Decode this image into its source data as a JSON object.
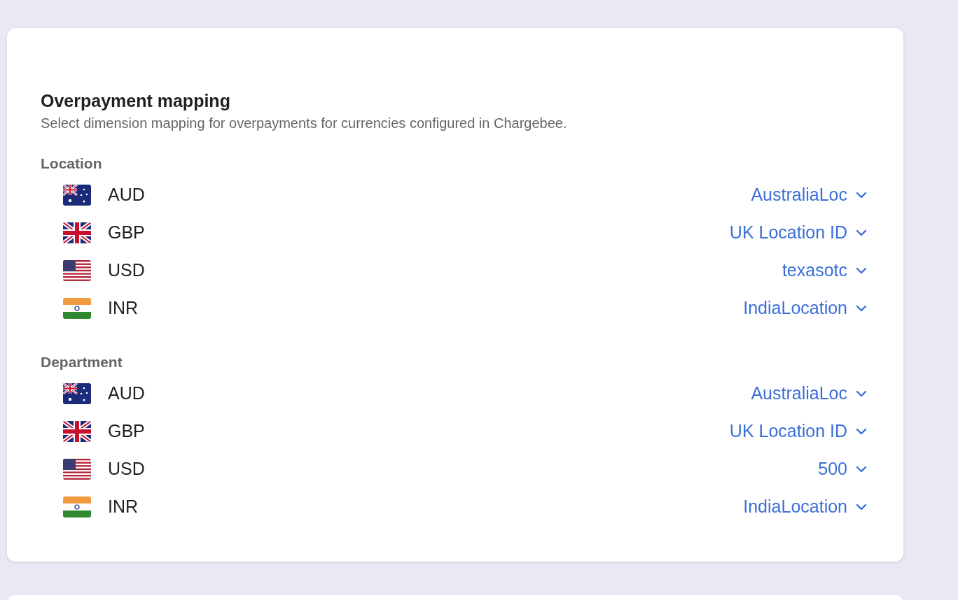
{
  "card": {
    "title": "Overpayment mapping",
    "description": "Select dimension mapping for overpayments for currencies configured in Chargebee.",
    "sections": [
      {
        "label": "Location",
        "rows": [
          {
            "currency": "AUD",
            "value": "AustraliaLoc"
          },
          {
            "currency": "GBP",
            "value": "UK Location ID"
          },
          {
            "currency": "USD",
            "value": "texasotc"
          },
          {
            "currency": "INR",
            "value": "IndiaLocation"
          }
        ]
      },
      {
        "label": "Department",
        "rows": [
          {
            "currency": "AUD",
            "value": "AustraliaLoc"
          },
          {
            "currency": "GBP",
            "value": "UK Location ID"
          },
          {
            "currency": "USD",
            "value": "500"
          },
          {
            "currency": "INR",
            "value": "IndiaLocation"
          }
        ]
      }
    ]
  }
}
